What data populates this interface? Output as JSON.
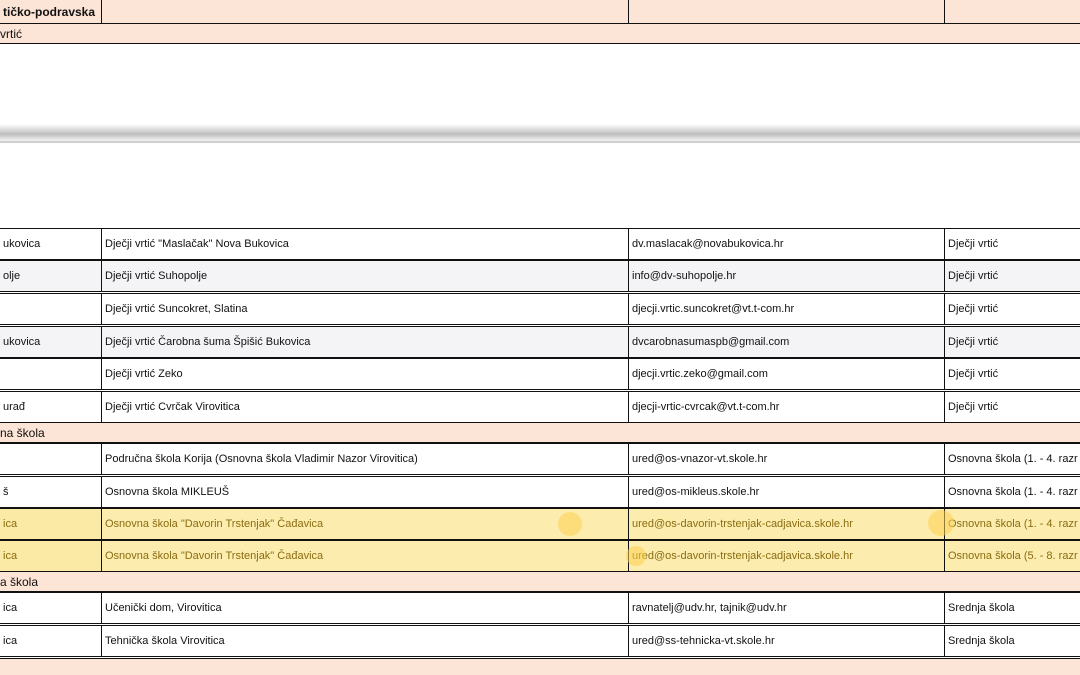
{
  "region": "tičko-podravska",
  "section_kindergarten": "vrtić",
  "kindergartens": [
    {
      "place": "ukovica",
      "name": "Dječji vrtić \"Maslačak\" Nova Bukovica",
      "email": "dv.maslacak@novabukovica.hr",
      "type": "Dječji vrtić"
    },
    {
      "place": "olje",
      "name": "Dječji vrtić Suhopolje",
      "email": "info@dv-suhopolje.hr",
      "type": "Dječji vrtić"
    },
    {
      "place": "",
      "name": "Dječji vrtić Suncokret, Slatina",
      "email": "djecji.vrtic.suncokret@vt.t-com.hr",
      "type": "Dječji vrtić"
    },
    {
      "place": "ukovica",
      "name": "Dječji vrtić Čarobna šuma Špišić Bukovica",
      "email": "dvcarobnasumaspb@gmail.com",
      "type": "Dječji vrtić"
    },
    {
      "place": "",
      "name": "Dječji vrtić Zeko",
      "email": "djecji.vrtic.zeko@gmail.com",
      "type": "Dječji vrtić"
    },
    {
      "place": "urađ",
      "name": "Dječji vrtić Cvrčak Virovitica",
      "email": "djecji-vrtic-cvrcak@vt.t-com.hr",
      "type": "Dječji vrtić"
    }
  ],
  "section_primary": "na škola",
  "primary_schools": [
    {
      "place": "",
      "name": "Područna škola Korija (Osnovna škola Vladimir Nazor Virovitica)",
      "email": "ured@os-vnazor-vt.skole.hr",
      "type": "Osnovna škola (1. - 4. razr"
    },
    {
      "place": "š",
      "name": "Osnovna škola MIKLEUŠ",
      "email": "ured@os-mikleus.skole.hr",
      "type": "Osnovna škola (1. - 4. razr"
    },
    {
      "place": "ica",
      "name": "Osnovna škola \"Davorin Trstenjak\" Čađavica",
      "email": "ured@os-davorin-trstenjak-cadjavica.skole.hr",
      "type": "Osnovna škola (1. - 4. razr"
    },
    {
      "place": "ica",
      "name": "Osnovna škola \"Davorin Trstenjak\" Čađavica",
      "email": "ured@os-davorin-trstenjak-cadjavica.skole.hr",
      "type": "Osnovna škola (5. - 8. razr"
    }
  ],
  "section_secondary": "a škola",
  "secondary_schools": [
    {
      "place": "ica",
      "name": "Učenički dom, Virovitica",
      "email": "ravnatelj@udv.hr, tajnik@udv.hr",
      "type": "Srednja škola"
    },
    {
      "place": "ica",
      "name": "Tehnička škola Virovitica",
      "email": "ured@ss-tehnicka-vt.skole.hr",
      "type": "Srednja škola"
    }
  ],
  "colors": {
    "header_fill": "#fce4d6",
    "highlight": "#fcecae",
    "alt_row": "#f4f4f7"
  }
}
